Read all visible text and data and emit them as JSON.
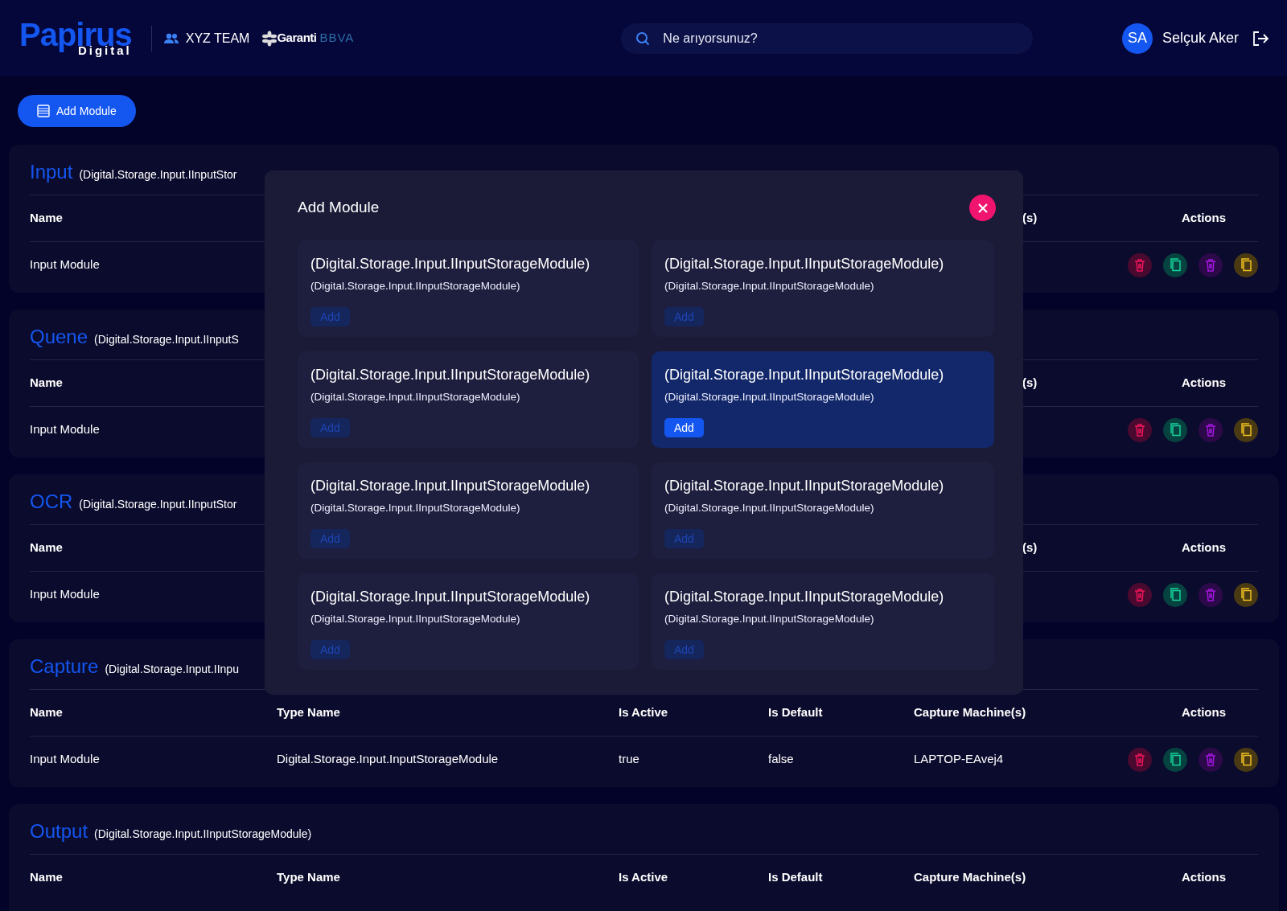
{
  "header": {
    "logo": {
      "name": "Papirus",
      "tagline": "Digital"
    },
    "team": "XYZ TEAM",
    "bank": {
      "name": "Garanti",
      "suffix": "BBVA"
    },
    "search": {
      "placeholder": "Ne arıyorsunuz?"
    },
    "user": {
      "initials": "SA",
      "name": "Selçuk Aker"
    }
  },
  "add_module_button": "Add Module",
  "sections": [
    {
      "title": "Input",
      "subtitle": "(Digital.Storage.Input.IInputStor",
      "columns": {
        "name": "Name",
        "capture_machines": "(s)",
        "actions": "Actions"
      },
      "rows": [
        {
          "name": "Input Module"
        }
      ]
    },
    {
      "title": "Quene",
      "subtitle": "(Digital.Storage.Input.IInputS",
      "columns": {
        "name": "Name",
        "capture_machines": "(s)",
        "actions": "Actions"
      },
      "rows": [
        {
          "name": "Input Module"
        }
      ]
    },
    {
      "title": "OCR",
      "subtitle": "(Digital.Storage.Input.IInputStor",
      "columns": {
        "name": "Name",
        "capture_machines": "(s)",
        "actions": "Actions"
      },
      "rows": [
        {
          "name": "Input Module"
        }
      ]
    },
    {
      "title": "Capture",
      "subtitle": "(Digital.Storage.Input.IInpu",
      "columns": {
        "name": "Name",
        "type_name": "Type Name",
        "is_active": "Is Active",
        "is_default": "Is Default",
        "capture_machines": "Capture Machine(s)",
        "actions": "Actions"
      },
      "rows": [
        {
          "name": "Input Module",
          "type_name": "Digital.Storage.Input.InputStorageModule",
          "is_active": "true",
          "is_default": "false",
          "capture_machines": "LAPTOP-EAvej4"
        }
      ]
    },
    {
      "title": "Output",
      "subtitle": "(Digital.Storage.Input.IInputStorageModule)",
      "columns": {
        "name": "Name",
        "type_name": "Type Name",
        "is_active": "Is Active",
        "is_default": "Is Default",
        "capture_machines": "Capture Machine(s)",
        "actions": "Actions"
      }
    }
  ],
  "modal": {
    "title": "Add Module",
    "cards": [
      {
        "title": "(Digital.Storage.Input.IInputStorageModule)",
        "subtitle": "(Digital.Storage.Input.IInputStorageModule)",
        "button": "Add",
        "selected": false
      },
      {
        "title": "(Digital.Storage.Input.IInputStorageModule)",
        "subtitle": "(Digital.Storage.Input.IInputStorageModule)",
        "button": "Add",
        "selected": false
      },
      {
        "title": "(Digital.Storage.Input.IInputStorageModule)",
        "subtitle": "(Digital.Storage.Input.IInputStorageModule)",
        "button": "Add",
        "selected": false
      },
      {
        "title": "(Digital.Storage.Input.IInputStorageModule)",
        "subtitle": "(Digital.Storage.Input.IInputStorageModule)",
        "button": "Add",
        "selected": true
      },
      {
        "title": "(Digital.Storage.Input.IInputStorageModule)",
        "subtitle": "(Digital.Storage.Input.IInputStorageModule)",
        "button": "Add",
        "selected": false
      },
      {
        "title": "(Digital.Storage.Input.IInputStorageModule)",
        "subtitle": "(Digital.Storage.Input.IInputStorageModule)",
        "button": "Add",
        "selected": false
      },
      {
        "title": "(Digital.Storage.Input.IInputStorageModule)",
        "subtitle": "(Digital.Storage.Input.IInputStorageModule)",
        "button": "Add",
        "selected": false
      },
      {
        "title": "(Digital.Storage.Input.IInputStorageModule)",
        "subtitle": "(Digital.Storage.Input.IInputStorageModule)",
        "button": "Add",
        "selected": false
      }
    ]
  }
}
